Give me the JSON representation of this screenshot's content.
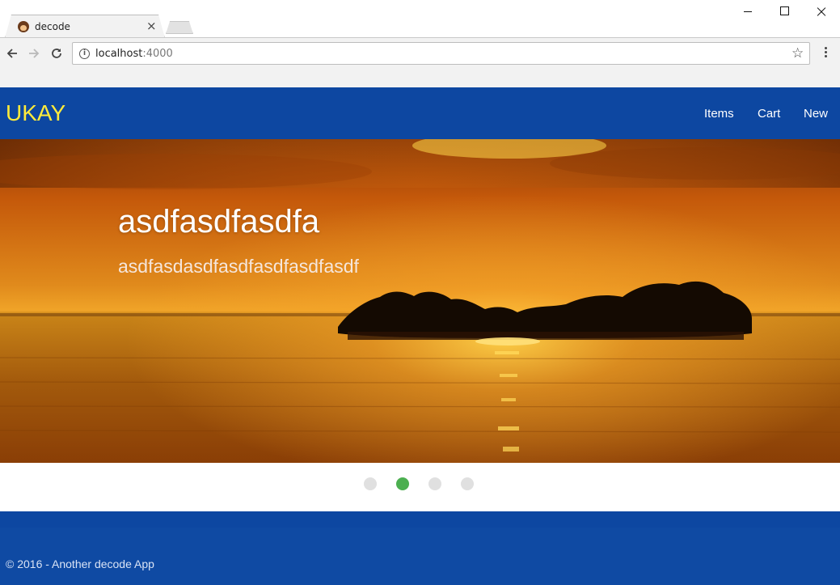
{
  "browser": {
    "tab_title": "decode",
    "tab_close": "×",
    "url_host": "localhost",
    "url_port": ":4000",
    "info_glyph": "i",
    "star_glyph": "☆"
  },
  "navbar": {
    "brand": "UKAY",
    "links": [
      "Items",
      "Cart",
      "New"
    ],
    "bg_color": "#0d47a1",
    "brand_color": "#ffeb3b"
  },
  "slider": {
    "title": "asdfasdfasdfa",
    "subtitle": "asdfasdasdfasdfasdfasdfasdf",
    "indicator_count": 4,
    "active_index": 1,
    "active_color": "#4caf50"
  },
  "footer": {
    "copyright": "© 2016 - Another decode App"
  },
  "icons": {
    "back": "arrow-left-icon",
    "forward": "arrow-right-icon",
    "reload": "reload-icon",
    "bookmark": "star-icon",
    "menu": "kebab-menu-icon"
  }
}
